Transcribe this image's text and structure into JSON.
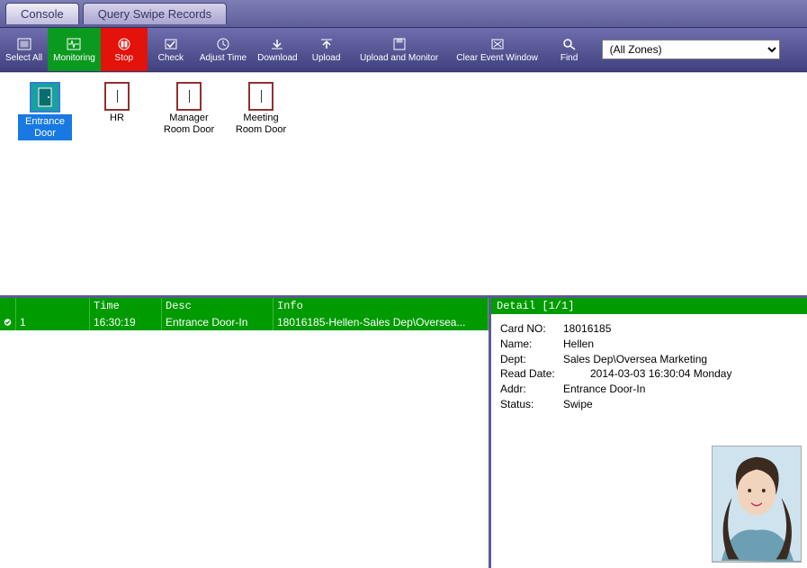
{
  "tabs": {
    "console": "Console",
    "query": "Query Swipe Records"
  },
  "toolbar": {
    "select_all": "Select All",
    "monitoring": "Monitoring",
    "stop": "Stop",
    "check": "Check",
    "adjust_time": "Adjust Time",
    "download": "Download",
    "upload": "Upload",
    "upload_monitor": "Upload and Monitor",
    "clear_event": "Clear Event Window",
    "find": "Find",
    "zone_selected": "(All Zones)"
  },
  "doors": {
    "entrance": "Entrance Door",
    "hr": "HR",
    "manager": "Manager Room Door",
    "meeting": "Meeting Room Door"
  },
  "event_headers": {
    "chk": "",
    "num": "",
    "time": "Time",
    "desc": "Desc",
    "info": "Info"
  },
  "event_row": {
    "num": "1",
    "time": "16:30:19",
    "desc": "Entrance Door-In",
    "info": "18016185-Hellen-Sales Dep\\Oversea..."
  },
  "detail_header": "Detail  [1/1]",
  "detail": {
    "card_lbl": "Card NO:",
    "card_val": "18016185",
    "name_lbl": "Name:",
    "name_val": "Hellen",
    "dept_lbl": "Dept:",
    "dept_val": "Sales Dep\\Oversea Marketing",
    "read_lbl": "Read Date:",
    "read_val": "2014-03-03 16:30:04 Monday",
    "addr_lbl": "Addr:",
    "addr_val": "Entrance Door-In",
    "status_lbl": "Status:",
    "status_val": "Swipe"
  }
}
